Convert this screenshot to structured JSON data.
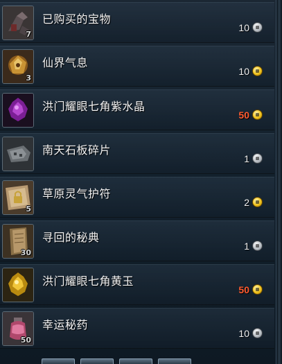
{
  "items": [
    {
      "name": "已购买的宝物",
      "count": "7",
      "price": "10",
      "currency": "silver",
      "price_color": "normal",
      "icon": "trade-bundle-icon"
    },
    {
      "name": "仙界气息",
      "count": "3",
      "price": "10",
      "currency": "gold",
      "price_color": "normal",
      "icon": "golden-herb-icon"
    },
    {
      "name": "洪门耀眼七角紫水晶",
      "count": "",
      "price": "50",
      "currency": "gold",
      "price_color": "red",
      "icon": "purple-crystal-icon"
    },
    {
      "name": "南天石板碎片",
      "count": "",
      "price": "1",
      "currency": "silver",
      "price_color": "normal",
      "icon": "stone-fragment-icon"
    },
    {
      "name": "草原灵气护符",
      "count": "5",
      "price": "2",
      "currency": "gold",
      "price_color": "normal",
      "icon": "lock-charm-icon"
    },
    {
      "name": "寻回的秘典",
      "count": "30",
      "price": "1",
      "currency": "silver",
      "price_color": "normal",
      "icon": "scroll-book-icon"
    },
    {
      "name": "洪门耀眼七角黄玉",
      "count": "",
      "price": "50",
      "currency": "gold",
      "price_color": "red",
      "icon": "yellow-topaz-icon"
    },
    {
      "name": "幸运秘药",
      "count": "50",
      "price": "10",
      "currency": "silver",
      "price_color": "normal",
      "icon": "potion-jar-icon"
    }
  ],
  "colors": {
    "red_price": "#ff5a2e",
    "gold": "#f1c21b",
    "silver": "#b9bec4"
  }
}
